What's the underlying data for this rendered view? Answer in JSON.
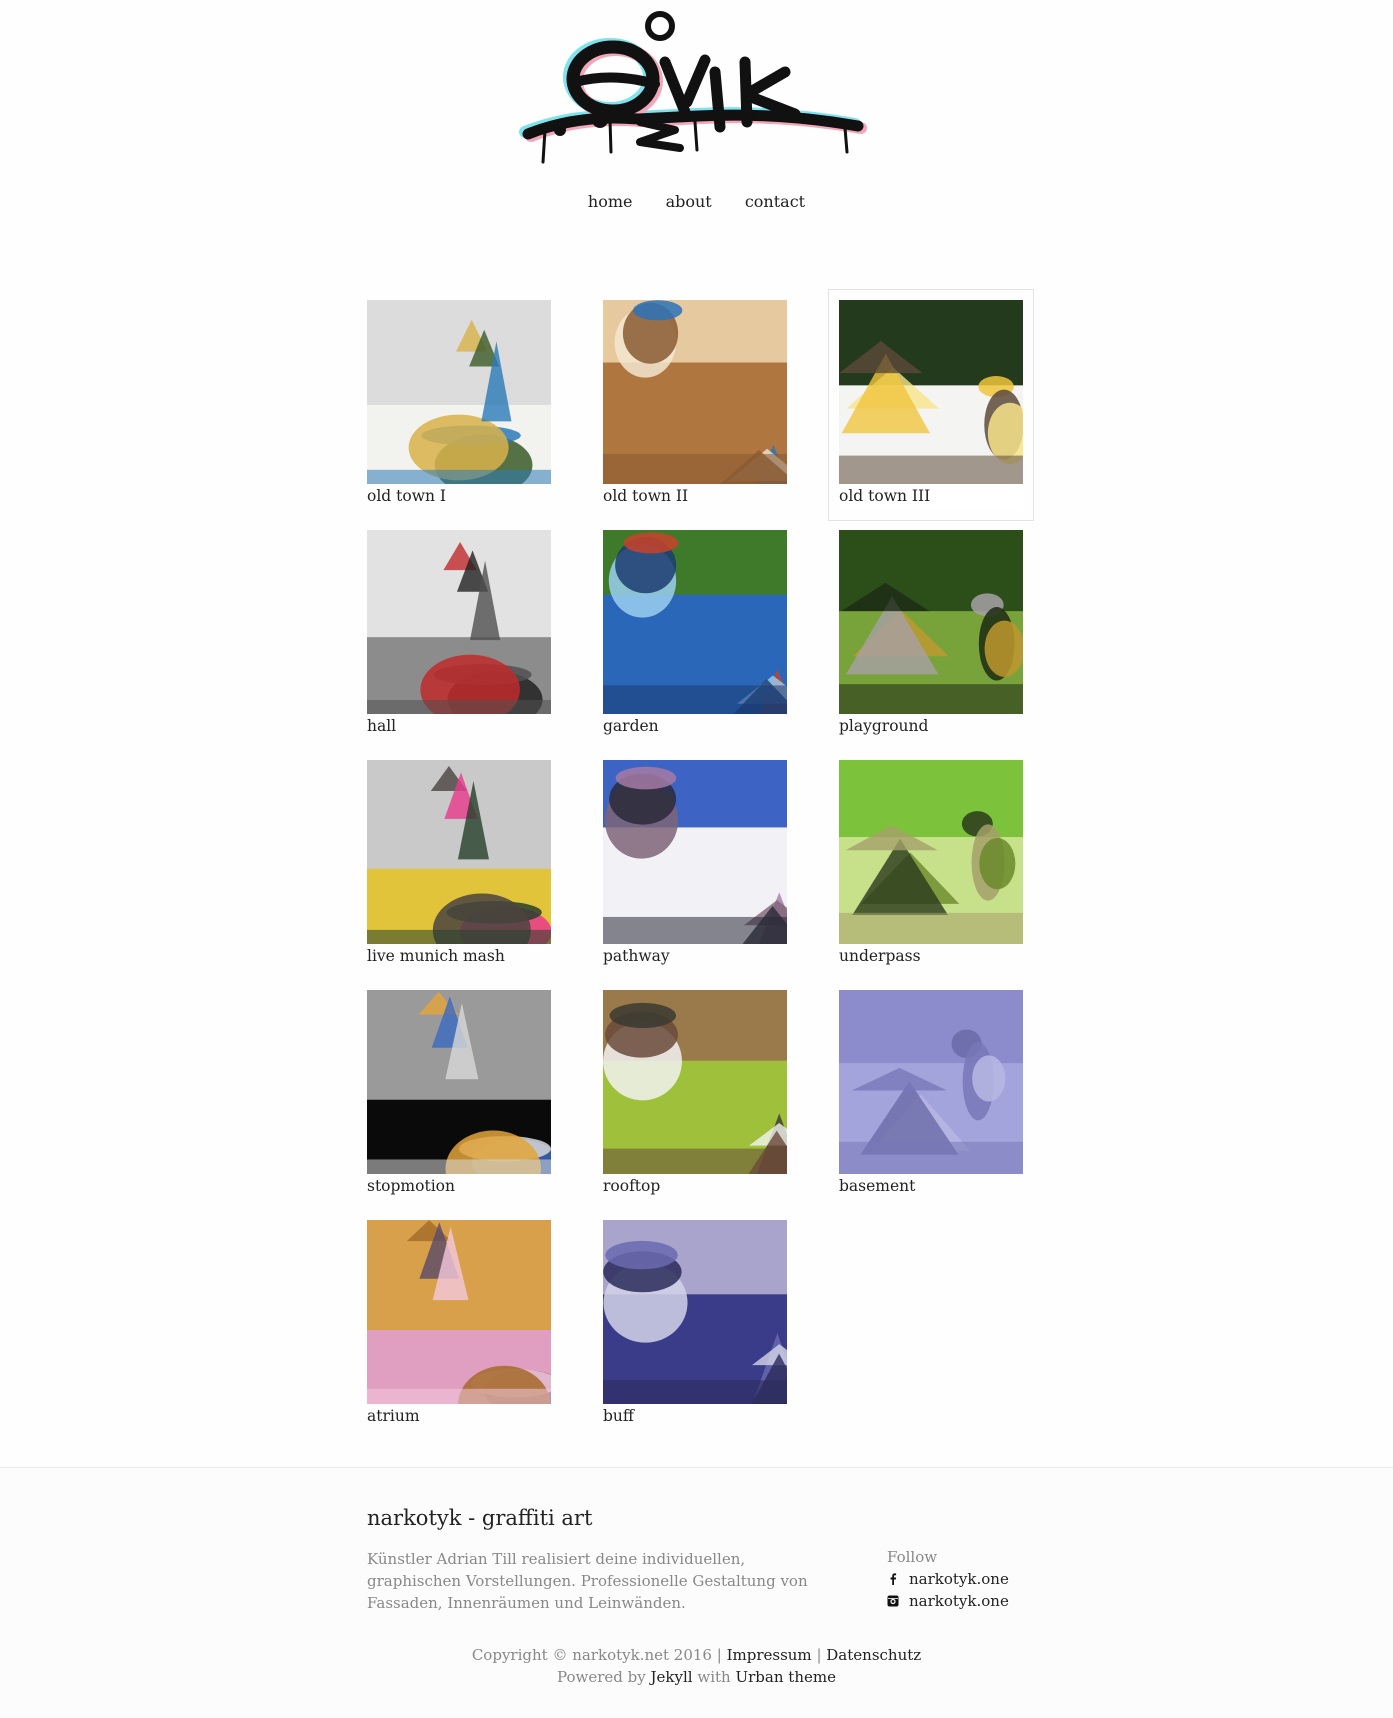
{
  "nav": {
    "items": [
      "home",
      "about",
      "contact"
    ]
  },
  "gallery": [
    {
      "label": "old town I",
      "colors": [
        "#dcdcdc",
        "#f2f2ee",
        "#3a5a28",
        "#d8b24a",
        "#2b7ab8"
      ]
    },
    {
      "label": "old town II",
      "colors": [
        "#e7c9a0",
        "#b0763f",
        "#f3e6cf",
        "#2b73b8",
        "#8a5a32"
      ]
    },
    {
      "label": "old town III",
      "colors": [
        "#233a1c",
        "#f4f4f2",
        "#f0c53d",
        "#f7e48a",
        "#5c4a3a"
      ]
    },
    {
      "label": "hall",
      "colors": [
        "#e2e2e2",
        "#8c8c8c",
        "#222222",
        "#c02a2a",
        "#505050"
      ]
    },
    {
      "label": "garden",
      "colors": [
        "#3f7a2a",
        "#2a67b8",
        "#9bd0ef",
        "#c8422a",
        "#1c3c72"
      ]
    },
    {
      "label": "playground",
      "colors": [
        "#2c4f19",
        "#78a33a",
        "#a7a0a6",
        "#c0982f",
        "#1d2a14"
      ]
    },
    {
      "label": "live munich mash",
      "colors": [
        "#c9c9c9",
        "#e2c43a",
        "#e83a8c",
        "#4a4440",
        "#27402c"
      ]
    },
    {
      "label": "pathway",
      "colors": [
        "#3d64c4",
        "#f2f2f6",
        "#7e6478",
        "#a47aa4",
        "#2a2a38"
      ]
    },
    {
      "label": "underpass",
      "colors": [
        "#7cc23a",
        "#c7e08a",
        "#2a3a1c",
        "#6a8a2a",
        "#a5a06a"
      ]
    },
    {
      "label": "stopmotion",
      "colors": [
        "#9a9a9a",
        "#0a0a0a",
        "#3a6ac0",
        "#e3a43a",
        "#d8d8d8"
      ]
    },
    {
      "label": "rooftop",
      "colors": [
        "#9a7a4a",
        "#9ec03a",
        "#f2f2f2",
        "#3a3a30",
        "#6a4a3a"
      ]
    },
    {
      "label": "basement",
      "colors": [
        "#8c8ccc",
        "#a4a4dc",
        "#6a6aa8",
        "#b8b8e4",
        "#7878b8"
      ]
    },
    {
      "label": "atrium",
      "colors": [
        "#d8a04a",
        "#e09ec0",
        "#5a4a6a",
        "#a46a2a",
        "#f4c8dc"
      ]
    },
    {
      "label": "buff",
      "colors": [
        "#a8a4cc",
        "#3a3c8a",
        "#d4d4e8",
        "#6a6ab0",
        "#2a2a5a"
      ]
    }
  ],
  "footer": {
    "title": "narkotyk - graffiti art",
    "description": "Künstler Adrian Till realisiert deine individuellen, graphischen Vorstellungen. Professionelle Gestaltung von Fassaden, Innenräumen und Leinwänden.",
    "follow_label": "Follow",
    "social": [
      {
        "icon": "facebook-icon",
        "label": "narkotyk.one"
      },
      {
        "icon": "instagram-icon",
        "label": "narkotyk.one"
      }
    ],
    "copyright": "Copyright © narkotyk.net 2016 |",
    "impressum": "Impressum",
    "sep": "|",
    "datenschutz": "Datenschutz",
    "powered_by": "Powered by",
    "jekyll": "Jekyll",
    "with": "with",
    "theme": "Urban theme"
  }
}
